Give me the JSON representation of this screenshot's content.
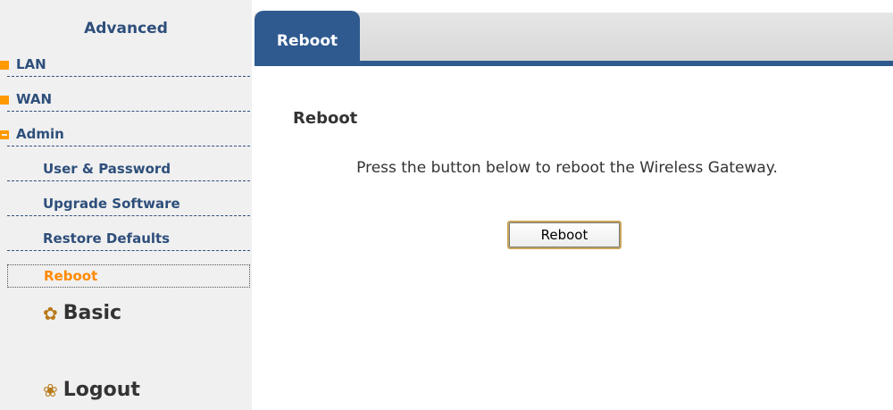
{
  "sidebar": {
    "title": "Advanced",
    "items": [
      {
        "label": "LAN"
      },
      {
        "label": "WAN"
      },
      {
        "label": "Admin"
      }
    ],
    "admin_sub": [
      {
        "label": "User & Password"
      },
      {
        "label": "Upgrade Software"
      },
      {
        "label": "Restore Defaults"
      },
      {
        "label": "Reboot"
      }
    ],
    "basic_label": "Basic",
    "logout_label": "Logout"
  },
  "tabs": {
    "active": "Reboot"
  },
  "content": {
    "title": "Reboot",
    "description": "Press the button below to reboot the Wireless Gateway.",
    "button_label": "Reboot"
  },
  "colors": {
    "accent": "#2f5a8f",
    "marker": "#ff9900",
    "active_text": "#ff8a00",
    "nav_text": "#2e4f7b"
  }
}
